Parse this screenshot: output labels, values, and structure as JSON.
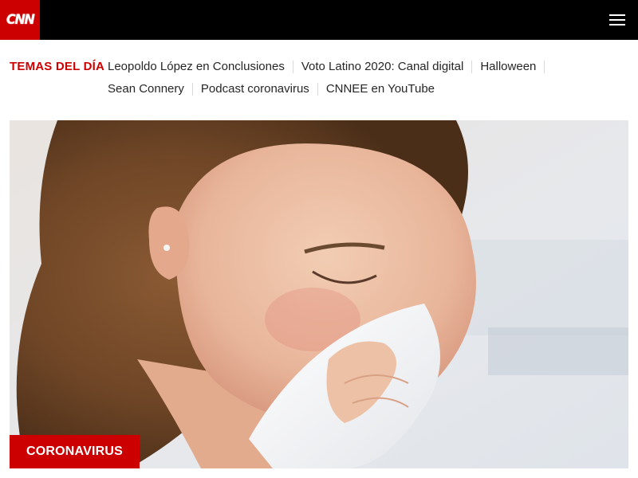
{
  "header": {
    "logo_text": "CNN",
    "menu_icon": "hamburger-menu-icon",
    "colors": {
      "bar": "#000000",
      "brand": "#cc0000"
    }
  },
  "trending": {
    "title": "TEMAS DEL DÍA",
    "items": [
      "Leopoldo López en Conclusiones",
      "Voto Latino 2020: Canal digital",
      "Halloween",
      "Sean Connery",
      "Podcast coronavirus",
      "CNNEE en YouTube"
    ]
  },
  "hero": {
    "category_label": "CORONAVIRUS",
    "image_subject": "woman-blowing-nose-into-tissue"
  }
}
